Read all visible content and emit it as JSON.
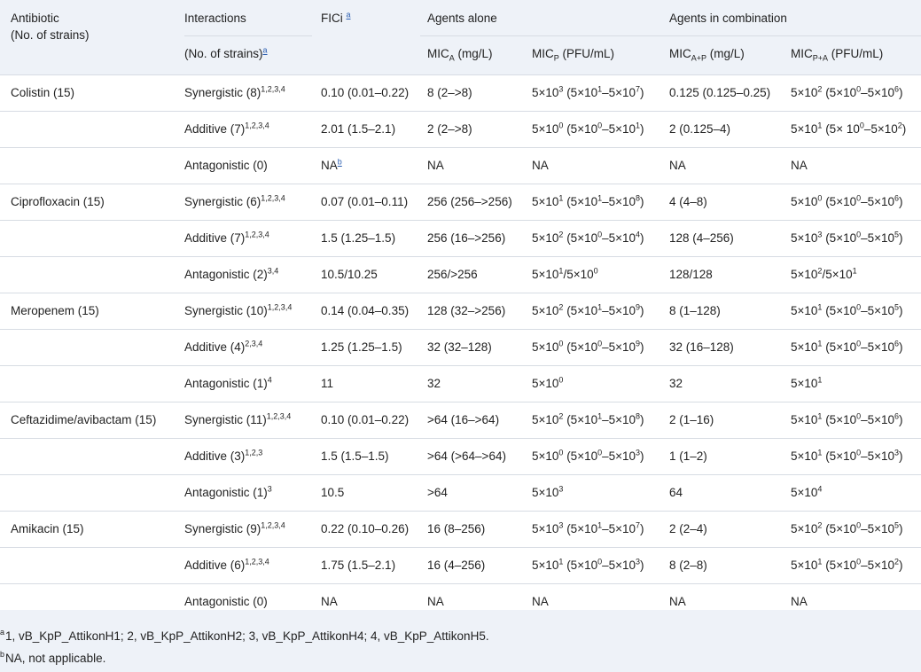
{
  "header": {
    "antibiotic_line1": "Antibiotic",
    "antibiotic_line2": "(No. of strains)",
    "interactions": "Interactions",
    "interactions_sub": "(No. of strains)",
    "interactions_sub_ref": "a",
    "fici": "FICi",
    "fici_ref": "a",
    "agents_alone": "Agents alone",
    "agents_combination": "Agents in combination",
    "mic_a": {
      "base": "MIC",
      "sub": "A",
      "unit": " (mg/L)"
    },
    "mic_p": {
      "base": "MIC",
      "sub": "P",
      "unit": " (PFU/mL)"
    },
    "mic_ap": {
      "base": "MIC",
      "sub": "A+P",
      "unit": " (mg/L)"
    },
    "mic_pa": {
      "base": "MIC",
      "sub": "P+A",
      "unit": " (PFU/mL)"
    }
  },
  "rows": [
    {
      "antibiotic": "Colistin (15)",
      "interaction": "Synergistic (8)",
      "phages": "1,2,3,4",
      "fici": "0.10 (0.01–0.22)",
      "mic_a": "8 (2–>8)",
      "mic_p": "5×10^3 (5×10^1–5×10^7)",
      "mic_ap": "0.125 (0.125–0.25)",
      "mic_pa": "5×10^2 (5×10^0–5×10^6)"
    },
    {
      "antibiotic": "",
      "interaction": "Additive (7)",
      "phages": "1,2,3,4",
      "fici": "2.01 (1.5–2.1)",
      "mic_a": "2 (2–>8)",
      "mic_p": "5×10^0 (5×10^0–5×10^1)",
      "mic_ap": "2 (0.125–4)",
      "mic_pa": "5×10^1 (5× 10^0–5×10^2)"
    },
    {
      "antibiotic": "",
      "interaction": "Antagonistic (0)",
      "phages": "",
      "fici": "NA",
      "fici_ref": "b",
      "mic_a": "NA",
      "mic_p": "NA",
      "mic_ap": "NA",
      "mic_pa": "NA"
    },
    {
      "antibiotic": "Ciprofloxacin (15)",
      "interaction": "Synergistic (6)",
      "phages": "1,2,3,4",
      "fici": "0.07 (0.01–0.11)",
      "mic_a": "256 (256–>256)",
      "mic_p": "5×10^1 (5×10^1–5×10^8)",
      "mic_ap": "4 (4–8)",
      "mic_pa": "5×10^0 (5×10^0–5×10^6)"
    },
    {
      "antibiotic": "",
      "interaction": "Additive (7)",
      "phages": "1,2,3,4",
      "fici": "1.5 (1.25–1.5)",
      "mic_a": "256 (16–>256)",
      "mic_p": "5×10^2 (5×10^0–5×10^4)",
      "mic_ap": "128 (4–256)",
      "mic_pa": "5×10^3 (5×10^0–5×10^5)"
    },
    {
      "antibiotic": "",
      "interaction": "Antagonistic (2)",
      "phages": "3,4",
      "fici": "10.5/10.25",
      "mic_a": "256/>256",
      "mic_p": "5×10^1/5×10^0",
      "mic_ap": "128/128",
      "mic_pa": "5×10^2/5×10^1"
    },
    {
      "antibiotic": "Meropenem (15)",
      "interaction": "Synergistic (10)",
      "phages": "1,2,3,4",
      "fici": "0.14 (0.04–0.35)",
      "mic_a": "128 (32–>256)",
      "mic_p": "5×10^2 (5×10^1–5×10^9)",
      "mic_ap": "8 (1–128)",
      "mic_pa": "5×10^1 (5×10^0–5×10^5)"
    },
    {
      "antibiotic": "",
      "interaction": "Additive (4)",
      "phages": "2,3,4",
      "fici": "1.25 (1.25–1.5)",
      "mic_a": "32 (32–128)",
      "mic_p": "5×10^0 (5×10^0–5×10^9)",
      "mic_ap": "32 (16–128)",
      "mic_pa": "5×10^1 (5×10^0–5×10^6)"
    },
    {
      "antibiotic": "",
      "interaction": "Antagonistic (1)",
      "phages": "4",
      "fici": "11",
      "mic_a": "32",
      "mic_p": "5×10^0",
      "mic_ap": "32",
      "mic_pa": "5×10^1"
    },
    {
      "antibiotic": "Ceftazidime/avibactam (15)",
      "interaction": "Synergistic (11)",
      "phages": "1,2,3,4",
      "fici": "0.10 (0.01–0.22)",
      "mic_a": ">64 (16–>64)",
      "mic_p": "5×10^2 (5×10^1–5×10^8)",
      "mic_ap": "2 (1–16)",
      "mic_pa": "5×10^1 (5×10^0–5×10^6)"
    },
    {
      "antibiotic": "",
      "interaction": "Additive (3)",
      "phages": "1,2,3",
      "fici": "1.5 (1.5–1.5)",
      "mic_a": ">64 (>64–>64)",
      "mic_p": "5×10^0 (5×10^0–5×10^3)",
      "mic_ap": "1 (1–2)",
      "mic_pa": "5×10^1 (5×10^0–5×10^3)"
    },
    {
      "antibiotic": "",
      "interaction": "Antagonistic (1)",
      "phages": "3",
      "fici": "10.5",
      "mic_a": ">64",
      "mic_p": "5×10^3",
      "mic_ap": "64",
      "mic_pa": "5×10^4"
    },
    {
      "antibiotic": "Amikacin (15)",
      "interaction": "Synergistic (9)",
      "phages": "1,2,3,4",
      "fici": "0.22 (0.10–0.26)",
      "mic_a": "16 (8–256)",
      "mic_p": "5×10^3 (5×10^1–5×10^7)",
      "mic_ap": "2 (2–4)",
      "mic_pa": "5×10^2 (5×10^0–5×10^5)"
    },
    {
      "antibiotic": "",
      "interaction": "Additive (6)",
      "phages": "1,2,3,4",
      "fici": "1.75 (1.5–2.1)",
      "mic_a": "16 (4–256)",
      "mic_p": "5×10^1 (5×10^0–5×10^3)",
      "mic_ap": "8 (2–8)",
      "mic_pa": "5×10^1 (5×10^0–5×10^2)"
    },
    {
      "antibiotic": "",
      "interaction": "Antagonistic (0)",
      "phages": "",
      "fici": "NA",
      "mic_a": "NA",
      "mic_p": "NA",
      "mic_ap": "NA",
      "mic_pa": "NA"
    }
  ],
  "footnotes": [
    {
      "mark": "a",
      "text": "1, vB_KpP_AttikonH1; 2, vB_KpP_AttikonH2; 3, vB_KpP_AttikonH4; 4, vB_KpP_AttikonH5."
    },
    {
      "mark": "b",
      "text": "NA, not applicable."
    }
  ],
  "colors": {
    "header_bg": "#eef2f8",
    "rule": "#d7dce3",
    "link": "#2a5db0",
    "text": "#222222"
  }
}
